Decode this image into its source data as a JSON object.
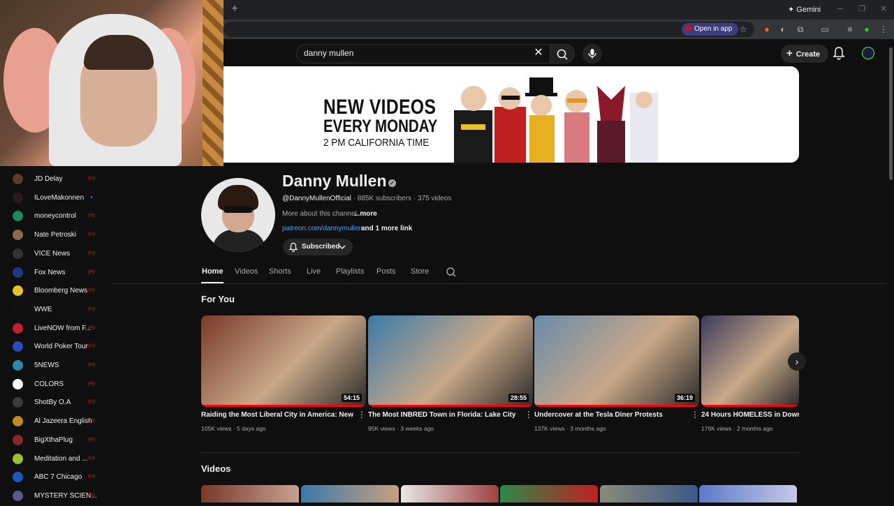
{
  "browser": {
    "new_tab_symbol": "+",
    "gemini_label": "Gemini",
    "open_in_app_label": "Open in app"
  },
  "search": {
    "query": "danny mullen"
  },
  "masthead": {
    "create_label": "Create"
  },
  "sidebar": {
    "subscriptions": [
      {
        "name": "JD Delay",
        "color": "#5a3a2a",
        "live": true
      },
      {
        "name": "ILoveMakonnen",
        "color": "#2a1a1a",
        "live": false
      },
      {
        "name": "moneycontrol",
        "color": "#1a8a5a",
        "live": true
      },
      {
        "name": "Nate Petroski",
        "color": "#8a6a4a",
        "live": true
      },
      {
        "name": "VICE News",
        "color": "#333333",
        "live": true
      },
      {
        "name": "Fox News",
        "color": "#1a3a8a",
        "live": true
      },
      {
        "name": "Bloomberg News",
        "color": "#e8c020",
        "live": true
      },
      {
        "name": "WWE",
        "color": "#111111",
        "live": true
      },
      {
        "name": "LiveNOW from F...",
        "color": "#c02030",
        "live": true
      },
      {
        "name": "World Poker Tour",
        "color": "#2a4ac0",
        "live": true
      },
      {
        "name": "5NEWS",
        "color": "#2a8aaa",
        "live": true
      },
      {
        "name": "COLORS",
        "color": "#ffffff",
        "live": true
      },
      {
        "name": "ShotBy O.A",
        "color": "#3a3a3a",
        "live": true
      },
      {
        "name": "Al Jazeera English",
        "color": "#c08a20",
        "live": true
      },
      {
        "name": "BigXthaPlug",
        "color": "#8a2a2a",
        "live": true
      },
      {
        "name": "Meditation and ...",
        "color": "#a0c030",
        "live": true
      },
      {
        "name": "ABC 7 Chicago",
        "color": "#1a5ac0",
        "live": true
      },
      {
        "name": "MYSTERY SCIEN...",
        "color": "#5a5a8a",
        "live": true
      }
    ]
  },
  "banner": {
    "line1": "NEW VIDEOS",
    "line2": "EVERY MONDAY",
    "line3": "2 PM CALIFORNIA TIME"
  },
  "channel": {
    "name": "Danny Mullen",
    "handle": "@DannyMullenOfficial",
    "subscribers": "885K subscribers",
    "videos": "375 videos",
    "description": "More about this channel",
    "more_label": "...more",
    "link": "patreon.com/dannymullen",
    "more_links": "and 1 more link",
    "subscribe_label": "Subscribed"
  },
  "tabs": [
    "Home",
    "Videos",
    "Shorts",
    "Live",
    "Playlists",
    "Posts",
    "Store"
  ],
  "for_you": {
    "heading": "For You",
    "videos": [
      {
        "title": "Raiding the Most Liberal City in America: New York",
        "views": "105K views",
        "age": "5 days ago",
        "duration": "54:15",
        "progress": 1.0,
        "color": "#7a3a2a"
      },
      {
        "title": "The Most INBRED Town in Florida: Lake City",
        "views": "95K views",
        "age": "3 weeks ago",
        "duration": "28:55",
        "progress": 1.0,
        "color": "#3a7aaa"
      },
      {
        "title": "Undercover at the Tesla Diner Protests",
        "views": "137K views",
        "age": "3 months ago",
        "duration": "36:19",
        "progress": 1.0,
        "color": "#6a8aaa"
      },
      {
        "title": "24 Hours HOMELESS in Downtow",
        "views": "176K views",
        "age": "2 months ago",
        "duration": "",
        "progress": 1.0,
        "color": "#3a3a5a"
      }
    ]
  },
  "videos_shelf": {
    "heading": "Videos"
  }
}
